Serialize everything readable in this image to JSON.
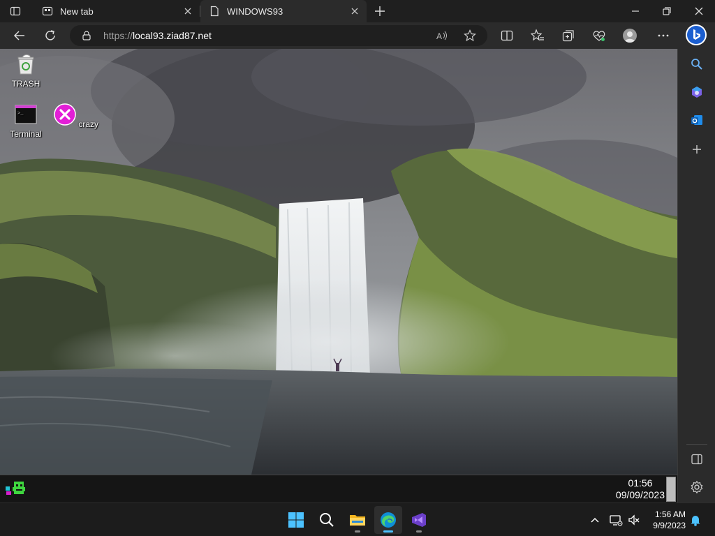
{
  "browser": {
    "tabs": [
      {
        "title": "New tab"
      },
      {
        "title": "WINDOWS93"
      }
    ],
    "address": {
      "scheme": "https://",
      "host": "local93.ziad87.net"
    }
  },
  "desktop": {
    "icons": [
      {
        "label": "TRASH",
        "icon": "trash-icon"
      },
      {
        "label": "Terminal",
        "icon": "terminal-icon"
      },
      {
        "label": "crazy",
        "icon": "crazy-x-icon"
      }
    ],
    "taskbar": {
      "time": "01:56",
      "date": "09/09/2023"
    }
  },
  "windows_taskbar": {
    "apps": [
      "start-icon",
      "search-icon",
      "file-explorer-icon",
      "edge-icon",
      "visual-studio-icon"
    ],
    "clock": {
      "time": "1:56 AM",
      "date": "9/9/2023"
    }
  },
  "colors": {
    "accent": "#4cc2ff",
    "crazy_magenta": "#e21fd6",
    "chrome_dark": "#1f1f1f"
  }
}
